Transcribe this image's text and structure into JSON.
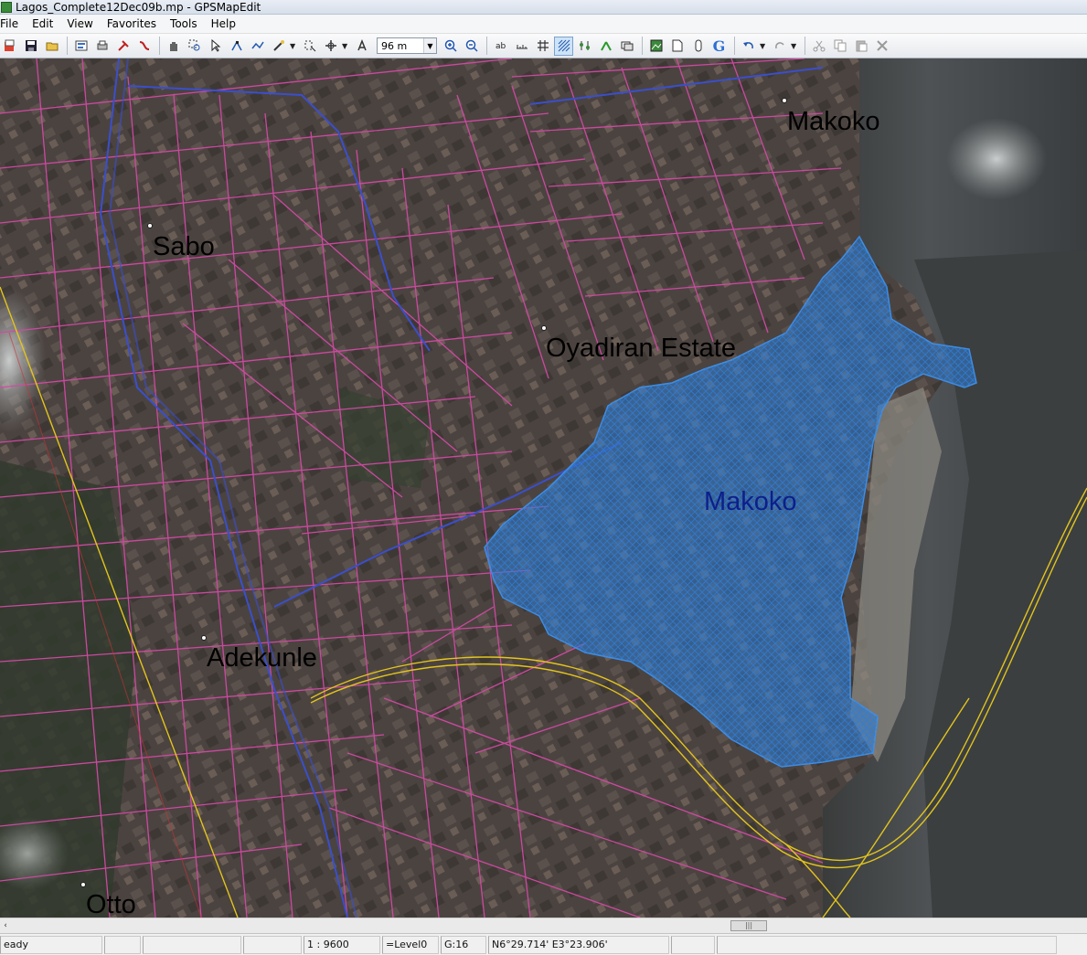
{
  "window": {
    "title": "Lagos_Complete12Dec09b.mp - GPSMapEdit"
  },
  "menu": [
    "File",
    "Edit",
    "View",
    "Favorites",
    "Tools",
    "Help"
  ],
  "toolbar": {
    "zoom_value": "96 m",
    "google_glyph": "G"
  },
  "map": {
    "labels": {
      "makoko_top": "Makoko",
      "sabo": "Sabo",
      "oyadiran": "Oyadiran Estate",
      "makoko_area": "Makoko",
      "adekunle": "Adekunle",
      "otto": "Otto"
    },
    "colors": {
      "roads": "#d24aa5",
      "highway": "#3a4fcc",
      "railway_primary": "#e3c51c",
      "area_fill": "#2f7dd6",
      "area_label": "#0c1f8c"
    }
  },
  "scrollbar": {
    "thumb_glyph": "|||",
    "left_glyph": "‹"
  },
  "status": {
    "ready": "eady",
    "scale": "1 : 9600",
    "level": "=Level0",
    "grid": "G:16",
    "coords": "N6°29.714' E3°23.906'"
  }
}
